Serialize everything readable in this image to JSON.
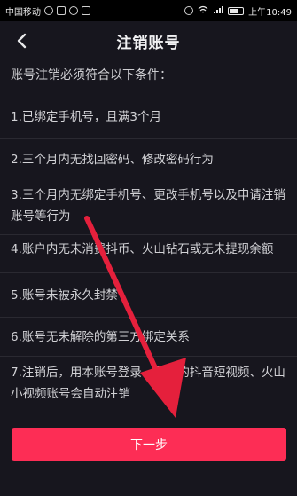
{
  "status_bar": {
    "carrier": "中国移动",
    "time": "上午10:49"
  },
  "nav": {
    "title": "注销账号"
  },
  "intro": "账号注销必须符合以下条件：",
  "conditions": [
    "1.已绑定手机号，且满3个月",
    "2.三个月内无找回密码、修改密码行为",
    "3.三个月内无绑定手机号、更改手机号以及申请注销账号等行为",
    "4.账户内无未消费抖币、火山钻石或无未提现余额",
    "5.账号未被永久封禁",
    "6.账号无未解除的第三方绑定关系",
    "7.注销后，用本账号登录、登录的抖音短视频、火山小视频账号会自动注销"
  ],
  "next_button": "下一步",
  "colors": {
    "background": "#17161e",
    "accent": "#fd2d55",
    "annotation_arrow": "#e5203c"
  }
}
